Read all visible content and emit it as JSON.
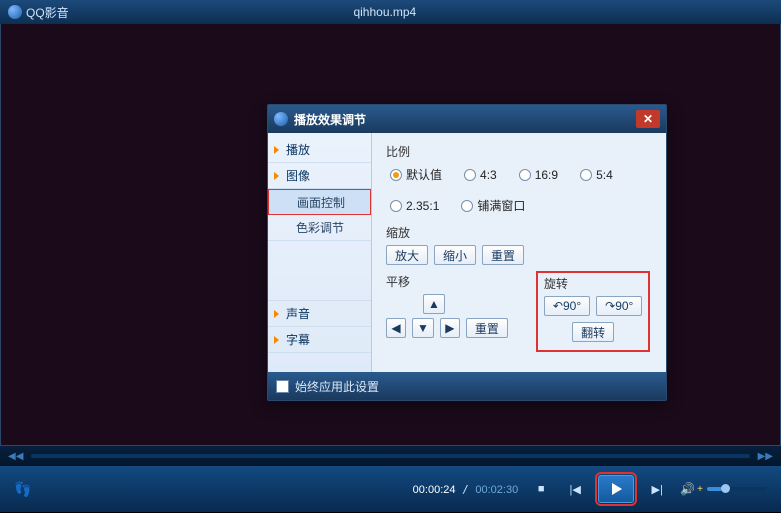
{
  "app": {
    "name": "QQ影音",
    "file": "qihhou.mp4"
  },
  "dialog": {
    "title": "播放效果调节",
    "tabs": {
      "play": "播放",
      "image": "图像",
      "frame_ctrl": "画面控制",
      "color_adj": "色彩调节",
      "sound": "声音",
      "subtitle": "字幕"
    },
    "ratio": {
      "label": "比例",
      "opts": {
        "default": "默认值",
        "r43": "4:3",
        "r169": "16:9",
        "r54": "5:4",
        "r2351": "2.35:1",
        "fill": "铺满窗口"
      }
    },
    "zoom": {
      "label": "缩放",
      "in": "放大",
      "out": "缩小",
      "reset": "重置"
    },
    "pan": {
      "label": "平移",
      "reset": "重置"
    },
    "rotate": {
      "label": "旋转",
      "left": "90°",
      "right": "90°",
      "flip": "翻转"
    },
    "always": "始终应用此设置"
  },
  "time": {
    "current": "00:00:24",
    "duration": "00:02:30"
  }
}
